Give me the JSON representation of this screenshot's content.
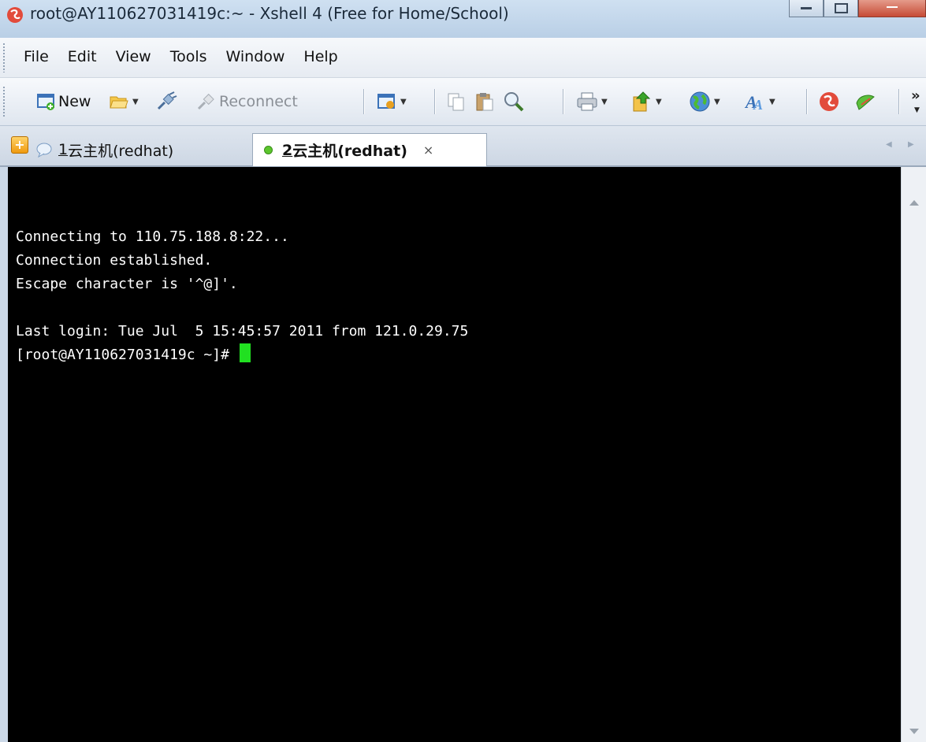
{
  "window": {
    "title": "root@AY110627031419c:~ - Xshell 4 (Free for Home/School)"
  },
  "menu": [
    "File",
    "Edit",
    "View",
    "Tools",
    "Window",
    "Help"
  ],
  "toolbar": {
    "new_label": "New",
    "reconnect_label": "Reconnect",
    "overflow": "»"
  },
  "tabs": [
    {
      "number": "1",
      "label": " 云主机(redhat)",
      "active": false
    },
    {
      "number": "2",
      "label": " 云主机(redhat)",
      "active": true,
      "close": "×"
    }
  ],
  "terminal": {
    "lines": [
      "",
      "Connecting to 110.75.188.8:22...",
      "Connection established.",
      "Escape character is '^@]'.",
      "",
      "Last login: Tue Jul  5 15:45:57 2011 from 121.0.29.75"
    ],
    "prompt": "[root@AY110627031419c ~]# ",
    "cursor_color": "#21e021",
    "background": "#000000",
    "foreground": "#ffffff"
  }
}
